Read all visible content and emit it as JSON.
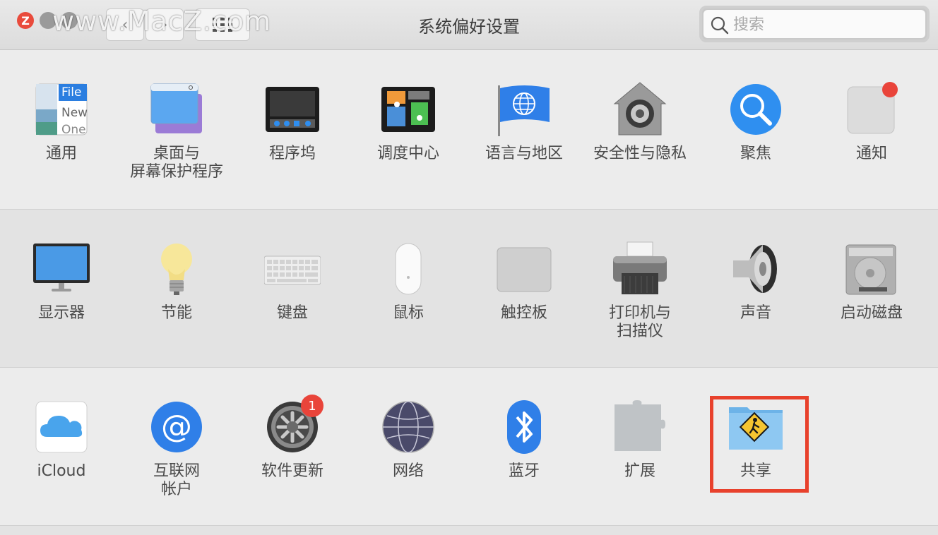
{
  "window": {
    "title": "系统偏好设置",
    "watermark": "www.MacZ.com",
    "close_glyph": "Z",
    "back_glyph": "‹",
    "forward_glyph": "›"
  },
  "search": {
    "placeholder": "搜索",
    "value": ""
  },
  "sections": [
    {
      "panes": [
        {
          "label": "通用",
          "icon": "general-icon",
          "file_text": "File",
          "new_text": "New",
          "open_text": "One"
        },
        {
          "label": "桌面与\n屏幕保护程序",
          "icon": "desktop-screensaver-icon"
        },
        {
          "label": "程序坞",
          "icon": "dock-icon"
        },
        {
          "label": "调度中心",
          "icon": "mission-control-icon"
        },
        {
          "label": "语言与地区",
          "icon": "language-region-icon"
        },
        {
          "label": "安全性与隐私",
          "icon": "security-privacy-icon"
        },
        {
          "label": "聚焦",
          "icon": "spotlight-icon"
        },
        {
          "label": "通知",
          "icon": "notifications-icon"
        }
      ]
    },
    {
      "panes": [
        {
          "label": "显示器",
          "icon": "displays-icon"
        },
        {
          "label": "节能",
          "icon": "energy-saver-icon"
        },
        {
          "label": "键盘",
          "icon": "keyboard-icon"
        },
        {
          "label": "鼠标",
          "icon": "mouse-icon"
        },
        {
          "label": "触控板",
          "icon": "trackpad-icon"
        },
        {
          "label": "打印机与\n扫描仪",
          "icon": "printers-scanners-icon"
        },
        {
          "label": "声音",
          "icon": "sound-icon"
        },
        {
          "label": "启动磁盘",
          "icon": "startup-disk-icon"
        }
      ]
    },
    {
      "panes": [
        {
          "label": "iCloud",
          "icon": "icloud-icon"
        },
        {
          "label": "互联网\n帐户",
          "icon": "internet-accounts-icon",
          "at_glyph": "@"
        },
        {
          "label": "软件更新",
          "icon": "software-update-icon",
          "badge": "1"
        },
        {
          "label": "网络",
          "icon": "network-icon"
        },
        {
          "label": "蓝牙",
          "icon": "bluetooth-icon"
        },
        {
          "label": "扩展",
          "icon": "extensions-icon"
        },
        {
          "label": "共享",
          "icon": "sharing-icon",
          "highlighted": true
        }
      ]
    }
  ],
  "colors": {
    "highlight": "#e8412c",
    "badge": "#e9443a",
    "accent_blue": "#2f7fe8"
  }
}
